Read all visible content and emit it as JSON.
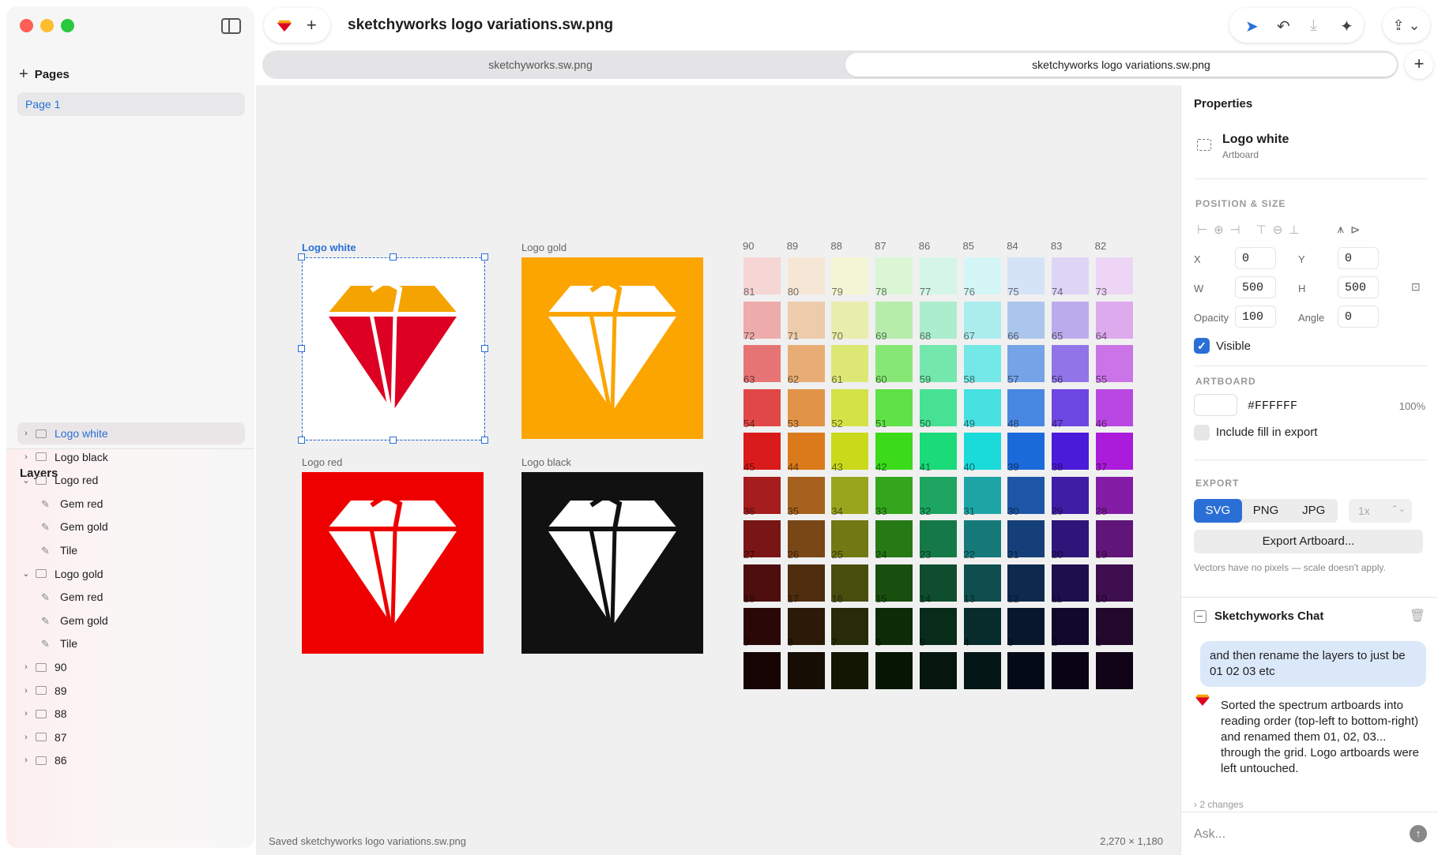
{
  "window": {
    "title": "sketchyworks logo variations.sw.png"
  },
  "sidebar": {
    "pages_label": "Pages",
    "pages": [
      {
        "label": "Page 1"
      }
    ],
    "layers_label": "Layers",
    "layers": [
      {
        "label": "Logo white",
        "kind": "artboard",
        "chevron": "›",
        "selected": true
      },
      {
        "label": "Logo black",
        "kind": "artboard",
        "chevron": "›"
      },
      {
        "label": "Logo red",
        "kind": "artboard",
        "chevron": "⌄"
      },
      {
        "label": "Gem red",
        "kind": "shape"
      },
      {
        "label": "Gem gold",
        "kind": "shape"
      },
      {
        "label": "Tile",
        "kind": "shape"
      },
      {
        "label": "Logo gold",
        "kind": "artboard",
        "chevron": "⌄"
      },
      {
        "label": "Gem red",
        "kind": "shape"
      },
      {
        "label": "Gem gold",
        "kind": "shape"
      },
      {
        "label": "Tile",
        "kind": "shape"
      },
      {
        "label": "90",
        "kind": "artboard",
        "chevron": "›"
      },
      {
        "label": "89",
        "kind": "artboard",
        "chevron": "›"
      },
      {
        "label": "88",
        "kind": "artboard",
        "chevron": "›"
      },
      {
        "label": "87",
        "kind": "artboard",
        "chevron": "›"
      },
      {
        "label": "86",
        "kind": "artboard",
        "chevron": "›"
      }
    ]
  },
  "tabs": [
    {
      "label": "sketchyworks.sw.png"
    },
    {
      "label": "sketchyworks logo variations.sw.png",
      "active": true
    }
  ],
  "toolbar_icons": [
    "pointer-icon",
    "undo-icon",
    "import-icon",
    "sparkle-icon",
    "share-icon"
  ],
  "canvas": {
    "status": "Saved sketchyworks logo variations.sw.png",
    "dimensions": "2,270 × 1,180",
    "artboards": [
      {
        "label": "Logo white",
        "bg": "#ffffff",
        "top": "#f5a300",
        "bottom": "#dd0022",
        "line": "#ffffff",
        "selected": true
      },
      {
        "label": "Logo gold",
        "bg": "#fca500",
        "top": "#ffffff",
        "bottom": "#ffffff",
        "line": "#fca500"
      },
      {
        "label": "Logo red",
        "bg": "#ef0000",
        "top": "#ffffff",
        "bottom": "#ffffff",
        "line": "#ef0000"
      },
      {
        "label": "Logo black",
        "bg": "#111111",
        "top": "#ffffff",
        "bottom": "#ffffff",
        "line": "#111111"
      }
    ],
    "column_labels": [
      "90",
      "89",
      "88",
      "87",
      "86",
      "85",
      "84",
      "83",
      "82"
    ],
    "swatch_hues": [
      0,
      30,
      65,
      110,
      150,
      180,
      215,
      255,
      285
    ],
    "swatch_rows": [
      {
        "lightness": 90,
        "saturation": 65,
        "labels": [
          "81",
          "80",
          "79",
          "78",
          "77",
          "76",
          "75",
          "74",
          "73"
        ]
      },
      {
        "lightness": 80,
        "saturation": 65,
        "labels": [
          "72",
          "71",
          "70",
          "69",
          "68",
          "67",
          "66",
          "65",
          "64"
        ]
      },
      {
        "lightness": 68,
        "saturation": 70,
        "labels": [
          "63",
          "62",
          "61",
          "60",
          "59",
          "58",
          "57",
          "56",
          "55"
        ]
      },
      {
        "lightness": 58,
        "saturation": 72,
        "labels": [
          "54",
          "53",
          "52",
          "51",
          "50",
          "49",
          "48",
          "47",
          "46"
        ]
      },
      {
        "lightness": 48,
        "saturation": 78,
        "labels": [
          "45",
          "44",
          "43",
          "42",
          "41",
          "40",
          "39",
          "38",
          "37"
        ]
      },
      {
        "lightness": 38,
        "saturation": 70,
        "labels": [
          "36",
          "35",
          "34",
          "33",
          "32",
          "31",
          "30",
          "29",
          "28"
        ]
      },
      {
        "lightness": 28,
        "saturation": 70,
        "labels": [
          "27",
          "26",
          "25",
          "24",
          "23",
          "22",
          "21",
          "20",
          "19"
        ]
      },
      {
        "lightness": 18,
        "saturation": 70,
        "labels": [
          "18",
          "17",
          "16",
          "15",
          "14",
          "13",
          "12",
          "11",
          "10"
        ]
      },
      {
        "lightness": 10,
        "saturation": 70,
        "labels": [
          "9",
          "8",
          "7",
          "6",
          "5",
          "4",
          "3",
          "2",
          "1"
        ]
      },
      {
        "lightness": 5,
        "saturation": 70,
        "labels": [
          "",
          "",
          "",
          "",
          "",
          "",
          "",
          "",
          ""
        ]
      }
    ]
  },
  "properties": {
    "title": "Properties",
    "object_name": "Logo white",
    "object_type": "Artboard",
    "position_size_label": "POSITION & SIZE",
    "x_label": "X",
    "x": "0",
    "y_label": "Y",
    "y": "0",
    "w_label": "W",
    "w": "500",
    "h_label": "H",
    "h": "500",
    "opacity_label": "Opacity",
    "opacity": "100",
    "angle_label": "Angle",
    "angle": "0",
    "visible_label": "Visible",
    "artboard_label": "ARTBOARD",
    "fill_hex": "#FFFFFF",
    "fill_opacity": "100%",
    "include_fill_label": "Include fill in export",
    "export_label": "EXPORT",
    "formats": [
      "SVG",
      "PNG",
      "JPG"
    ],
    "active_format": "SVG",
    "scale": "1x",
    "export_button": "Export Artboard...",
    "export_note": "Vectors have no pixels — scale doesn't apply."
  },
  "chat": {
    "title": "Sketchyworks Chat",
    "user_message": "and then rename the layers to just be 01 02 03 etc",
    "assistant_message": "Sorted the spectrum artboards into reading order (top-left to bottom-right) and renamed them 01, 02, 03... through the grid. Logo artboards were left untouched.",
    "changes": "› 2 changes",
    "input_placeholder": "Ask..."
  }
}
